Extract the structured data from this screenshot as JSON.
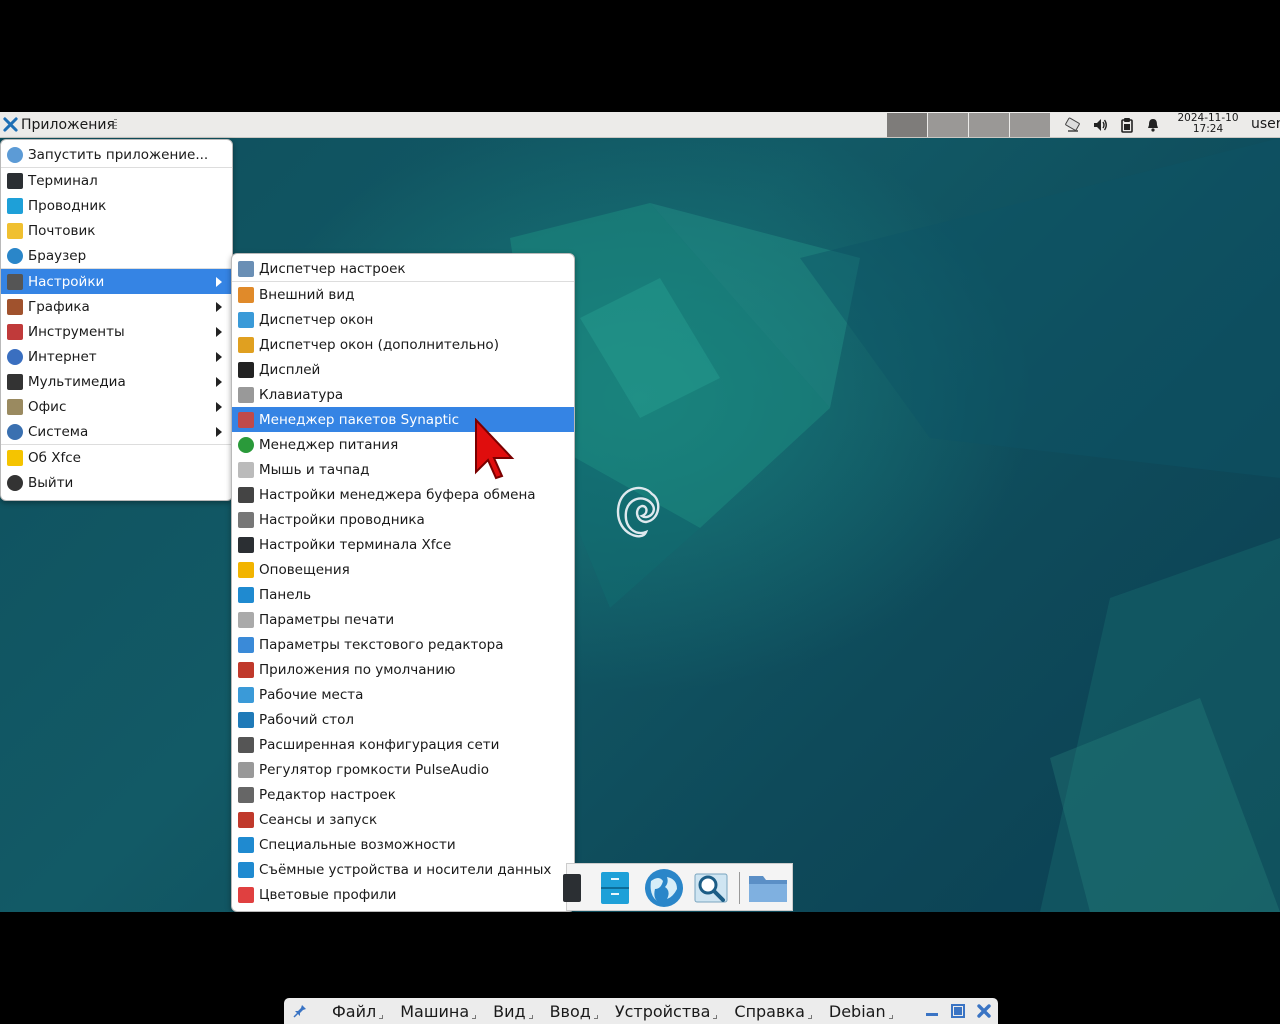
{
  "top_panel": {
    "apps_label": "Приложения",
    "clock_date": "2024-11-10",
    "clock_time": "17:24",
    "user": "user",
    "workspaces": 4,
    "tray_icons": [
      "network-icon",
      "volume-icon",
      "clipboard-icon",
      "notification-bell-icon"
    ]
  },
  "main_menu": {
    "items": [
      {
        "label": "Запустить приложение...",
        "icon": "search-icon"
      },
      {
        "label": "Терминал",
        "icon": "terminal-icon"
      },
      {
        "label": "Проводник",
        "icon": "file-manager-icon"
      },
      {
        "label": "Почтовик",
        "icon": "mail-icon"
      },
      {
        "label": "Браузер",
        "icon": "browser-icon"
      },
      {
        "label": "Настройки",
        "icon": "settings-icon",
        "submenu": true,
        "active": true
      },
      {
        "label": "Графика",
        "icon": "graphics-icon",
        "submenu": true
      },
      {
        "label": "Инструменты",
        "icon": "tools-icon",
        "submenu": true
      },
      {
        "label": "Интернет",
        "icon": "internet-icon",
        "submenu": true
      },
      {
        "label": "Мультимедиа",
        "icon": "multimedia-icon",
        "submenu": true
      },
      {
        "label": "Офис",
        "icon": "office-icon",
        "submenu": true
      },
      {
        "label": "Система",
        "icon": "system-icon",
        "submenu": true
      },
      {
        "label": "Об Xfce",
        "icon": "star-icon"
      },
      {
        "label": "Выйти",
        "icon": "logout-icon"
      }
    ]
  },
  "settings_menu": {
    "items": [
      {
        "label": "Диспетчер настроек",
        "icon": "settings-manager-icon"
      },
      {
        "label": "Внешний вид",
        "icon": "appearance-icon"
      },
      {
        "label": "Диспетчер окон",
        "icon": "window-manager-icon"
      },
      {
        "label": "Диспетчер окон (дополнительно)",
        "icon": "window-manager-tweaks-icon"
      },
      {
        "label": "Дисплей",
        "icon": "display-icon"
      },
      {
        "label": "Клавиатура",
        "icon": "keyboard-icon"
      },
      {
        "label": "Менеджер пакетов Synaptic",
        "icon": "synaptic-icon",
        "active": true
      },
      {
        "label": "Менеджер питания",
        "icon": "power-icon"
      },
      {
        "label": "Мышь и тачпад",
        "icon": "mouse-icon"
      },
      {
        "label": "Настройки менеджера буфера обмена",
        "icon": "clipboard-settings-icon"
      },
      {
        "label": "Настройки проводника",
        "icon": "file-manager-settings-icon"
      },
      {
        "label": "Настройки терминала Xfce",
        "icon": "terminal-settings-icon"
      },
      {
        "label": "Оповещения",
        "icon": "bell-icon"
      },
      {
        "label": "Панель",
        "icon": "panel-icon"
      },
      {
        "label": "Параметры печати",
        "icon": "printer-icon"
      },
      {
        "label": "Параметры текстового редактора",
        "icon": "text-editor-icon"
      },
      {
        "label": "Приложения по умолчанию",
        "icon": "default-apps-icon"
      },
      {
        "label": "Рабочие места",
        "icon": "workspaces-icon"
      },
      {
        "label": "Рабочий стол",
        "icon": "desktop-icon"
      },
      {
        "label": "Расширенная конфигурация сети",
        "icon": "network-config-icon"
      },
      {
        "label": "Регулятор громкости PulseAudio",
        "icon": "pulseaudio-icon"
      },
      {
        "label": "Редактор настроек",
        "icon": "settings-editor-icon"
      },
      {
        "label": "Сеансы и запуск",
        "icon": "session-icon"
      },
      {
        "label": "Специальные возможности",
        "icon": "accessibility-icon"
      },
      {
        "label": "Съёмные устройства и носители данных",
        "icon": "removable-drives-icon"
      },
      {
        "label": "Цветовые профили",
        "icon": "color-profiles-icon"
      }
    ]
  },
  "dock": {
    "items": [
      "terminal-icon",
      "file-manager-icon",
      "browser-icon",
      "app-finder-icon",
      "folder-icon"
    ]
  },
  "vbox_bar": {
    "menus": [
      "Файл",
      "Машина",
      "Вид",
      "Ввод",
      "Устройства",
      "Справка",
      "Debian"
    ]
  },
  "colors": {
    "accent": "#3584e4",
    "desktop": "#0f4f5d",
    "panel": "#ecebe9"
  }
}
